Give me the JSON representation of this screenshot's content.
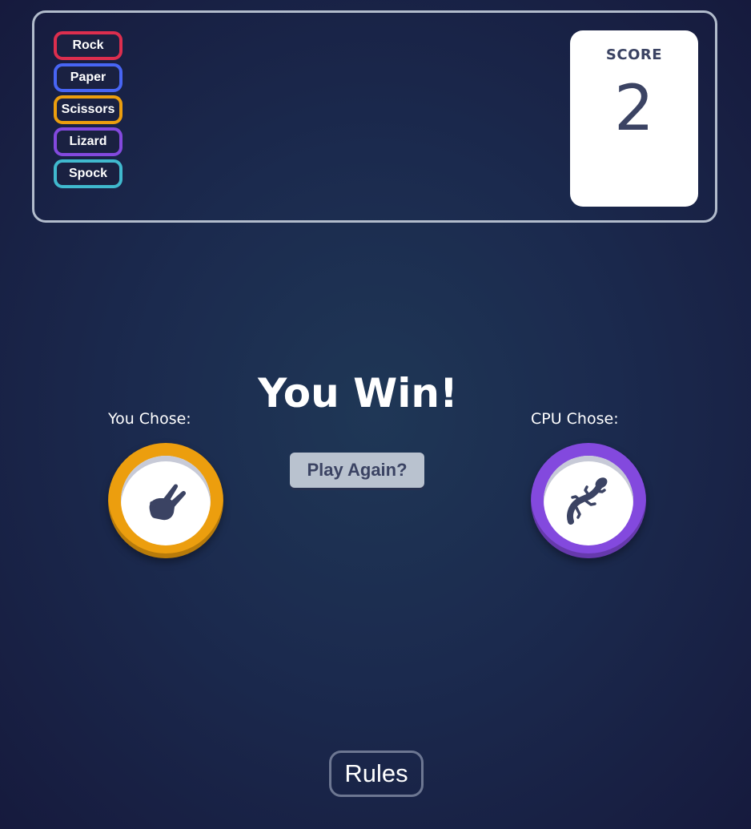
{
  "header": {
    "legend": [
      {
        "label": "Rock",
        "color": "#dc2e4e"
      },
      {
        "label": "Paper",
        "color": "#4865f4"
      },
      {
        "label": "Scissors",
        "color": "#ec9e0e"
      },
      {
        "label": "Lizard",
        "color": "#8349de"
      },
      {
        "label": "Spock",
        "color": "#40b9ce"
      }
    ],
    "score": {
      "label": "SCORE",
      "value": "2"
    }
  },
  "game": {
    "result": "You Win!",
    "player": {
      "label": "You Chose:",
      "choice": "Scissors",
      "ring_color": "#ec9e0e",
      "icon": "scissors-hand-icon"
    },
    "cpu": {
      "label": "CPU Chose:",
      "choice": "Lizard",
      "ring_color": "#8349de",
      "icon": "lizard-icon"
    },
    "play_again_label": "Play Again?"
  },
  "footer": {
    "rules_label": "Rules"
  },
  "colors": {
    "icon": "#3b4363",
    "background": "#1f3756"
  }
}
